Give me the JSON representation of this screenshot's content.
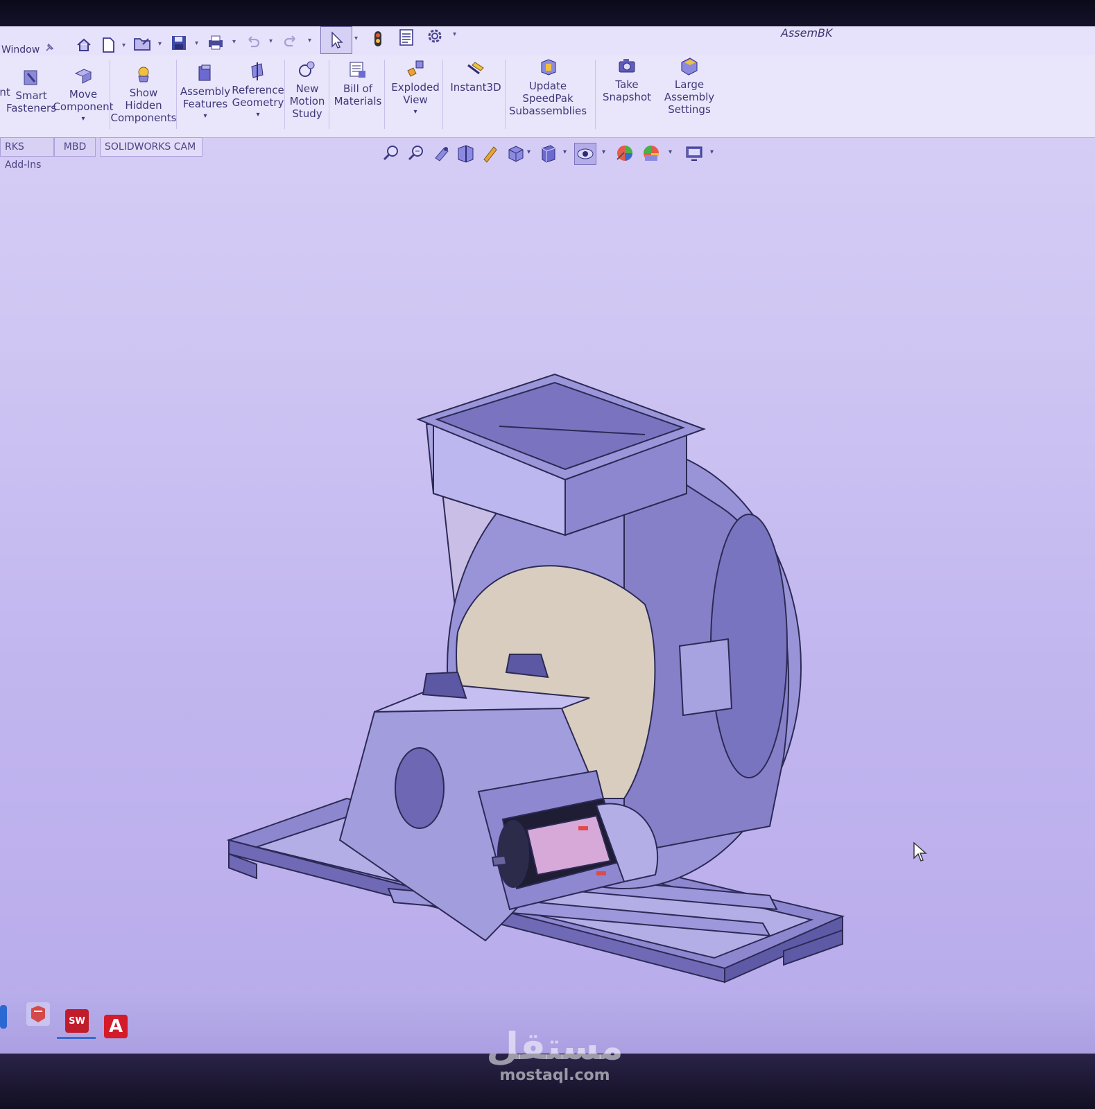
{
  "titlebar": {
    "menu_label": "Window",
    "doc_title": "AssemBK"
  },
  "ribbon": {
    "partial_left": "nt",
    "items": [
      {
        "label": "Smart\nFasteners"
      },
      {
        "label": "Move\nComponent"
      },
      {
        "label": "Show\nHidden\nComponents"
      },
      {
        "label": "Assembly\nFeatures"
      },
      {
        "label": "Reference\nGeometry"
      },
      {
        "label": "New\nMotion\nStudy"
      },
      {
        "label": "Bill of\nMaterials"
      },
      {
        "label": "Exploded\nView"
      },
      {
        "label": "Instant3D"
      },
      {
        "label": "Update\nSpeedPak\nSubassemblies"
      },
      {
        "label": "Take\nSnapshot"
      },
      {
        "label": "Large\nAssembly\nSettings"
      }
    ]
  },
  "tabs": {
    "addins": "RKS Add-Ins",
    "mbd": "MBD",
    "cam": "SOLIDWORKS CAM"
  },
  "taskbar": {
    "autocad_letter": "A",
    "sw_label": "SW"
  },
  "watermark": {
    "arabic": "مستقل",
    "latin": "mostaql.com"
  }
}
